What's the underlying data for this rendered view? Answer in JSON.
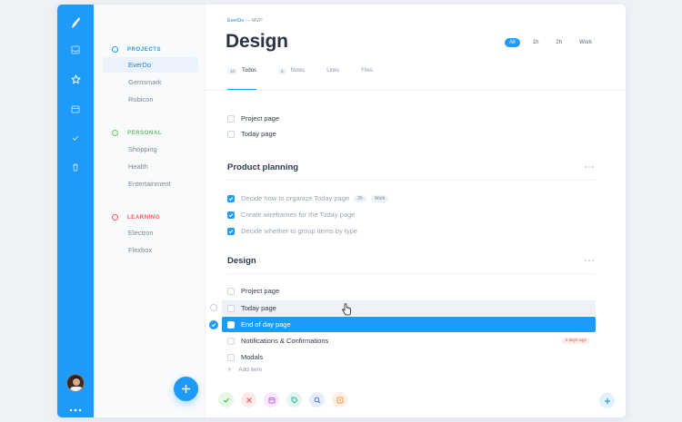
{
  "sidebar": {
    "sections": [
      {
        "title": "PROJECTS",
        "color": "#1e9bf8",
        "items": [
          "EverDo",
          "Gemsmark",
          "Rubicon"
        ]
      },
      {
        "title": "PERSONAL",
        "color": "#62c462",
        "items": [
          "Shopping",
          "Health",
          "Entertainment"
        ]
      },
      {
        "title": "LEARNING",
        "color": "#f0585c",
        "items": [
          "Electron",
          "Flexbox"
        ]
      }
    ],
    "active_item": "EverDo"
  },
  "rail": {
    "icons": [
      "logo-feather-icon",
      "inbox-icon",
      "star-icon",
      "calendar-icon",
      "check-icon",
      "trash-icon"
    ]
  },
  "main": {
    "breadcrumb": {
      "project": "EverDo",
      "separator": "—",
      "page": "MVP"
    },
    "title": "Design",
    "filters": [
      "All",
      "1h",
      "2h",
      "Work"
    ],
    "active_filter": "All",
    "tabs": [
      {
        "count": "10",
        "label": "Todos"
      },
      {
        "count": "3",
        "label": "Notes"
      },
      {
        "count": "",
        "label": "Links"
      },
      {
        "count": "",
        "label": "Files"
      }
    ],
    "loose_todos": [
      "Project page",
      "Today page"
    ],
    "groups": [
      {
        "title": "Product planning",
        "todos": [
          {
            "text": "Decide how to organize Today page",
            "tags": [
              "2h",
              "Work"
            ],
            "done": true
          },
          {
            "text": "Create wireframes for the Today page",
            "tags": [],
            "done": true
          },
          {
            "text": "Decide whether to group items by type",
            "tags": [],
            "done": true
          }
        ]
      },
      {
        "title": "Design",
        "todos": [
          {
            "text": "Project page",
            "state": "normal"
          },
          {
            "text": "Today page",
            "state": "hover"
          },
          {
            "text": "End of day page",
            "state": "selected"
          },
          {
            "text": "Notifications & Confirmations",
            "state": "normal",
            "due": "2 days ago"
          },
          {
            "text": "Modals",
            "state": "normal"
          }
        ]
      }
    ],
    "add_item_label": "Add item"
  },
  "toolbar": {
    "buttons": [
      {
        "name": "complete-icon",
        "bg": "#e6f7e6",
        "fg": "#4fbf4f"
      },
      {
        "name": "delete-icon",
        "bg": "#fdeaea",
        "fg": "#ef5b5b"
      },
      {
        "name": "calendar-icon",
        "bg": "#f8e8fb",
        "fg": "#c66bd8"
      },
      {
        "name": "tag-icon",
        "bg": "#e4f6f2",
        "fg": "#31b89c"
      },
      {
        "name": "search-icon",
        "bg": "#e7eefb",
        "fg": "#4a78d6"
      },
      {
        "name": "move-icon",
        "bg": "#fdf0e2",
        "fg": "#f2994a"
      }
    ]
  }
}
